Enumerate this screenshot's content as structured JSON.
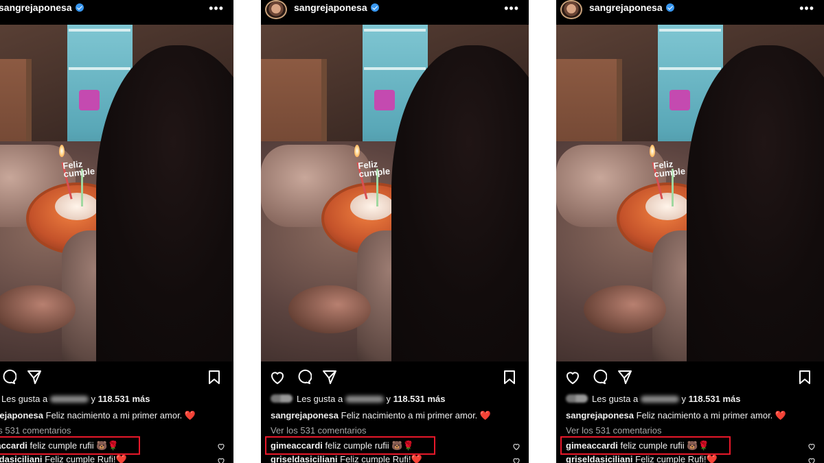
{
  "post": {
    "username": "sangrejaponesa",
    "likes_prefix": "Les gusta a",
    "likes_connector": "y",
    "likes_count": "118.531 más",
    "caption_text": "Feliz nacimiento a mi primer amor.",
    "caption_emoji": "❤️",
    "view_comments": "Ver los 531 comentarios",
    "comments": [
      {
        "user": "gimeaccardi",
        "text": "feliz cumple rufii",
        "emoji": "🐻🌹"
      },
      {
        "user": "griseldasiciliani",
        "text": "Feliz cumple Rufi!",
        "emoji": "❤️"
      }
    ],
    "photo": {
      "topper_line1": "Feliz",
      "topper_line2": "cumple"
    }
  },
  "panels": [
    {
      "id": "left"
    },
    {
      "id": "middle"
    },
    {
      "id": "right"
    }
  ],
  "colors": {
    "background": "#000000",
    "highlight": "#e8182a",
    "verified": "#3897f0",
    "like_heart": "#ed2b3a"
  },
  "icons": [
    "verified-badge-icon",
    "more-options-icon",
    "heart-icon",
    "comment-icon",
    "share-icon",
    "bookmark-icon",
    "small-heart-icon"
  ]
}
